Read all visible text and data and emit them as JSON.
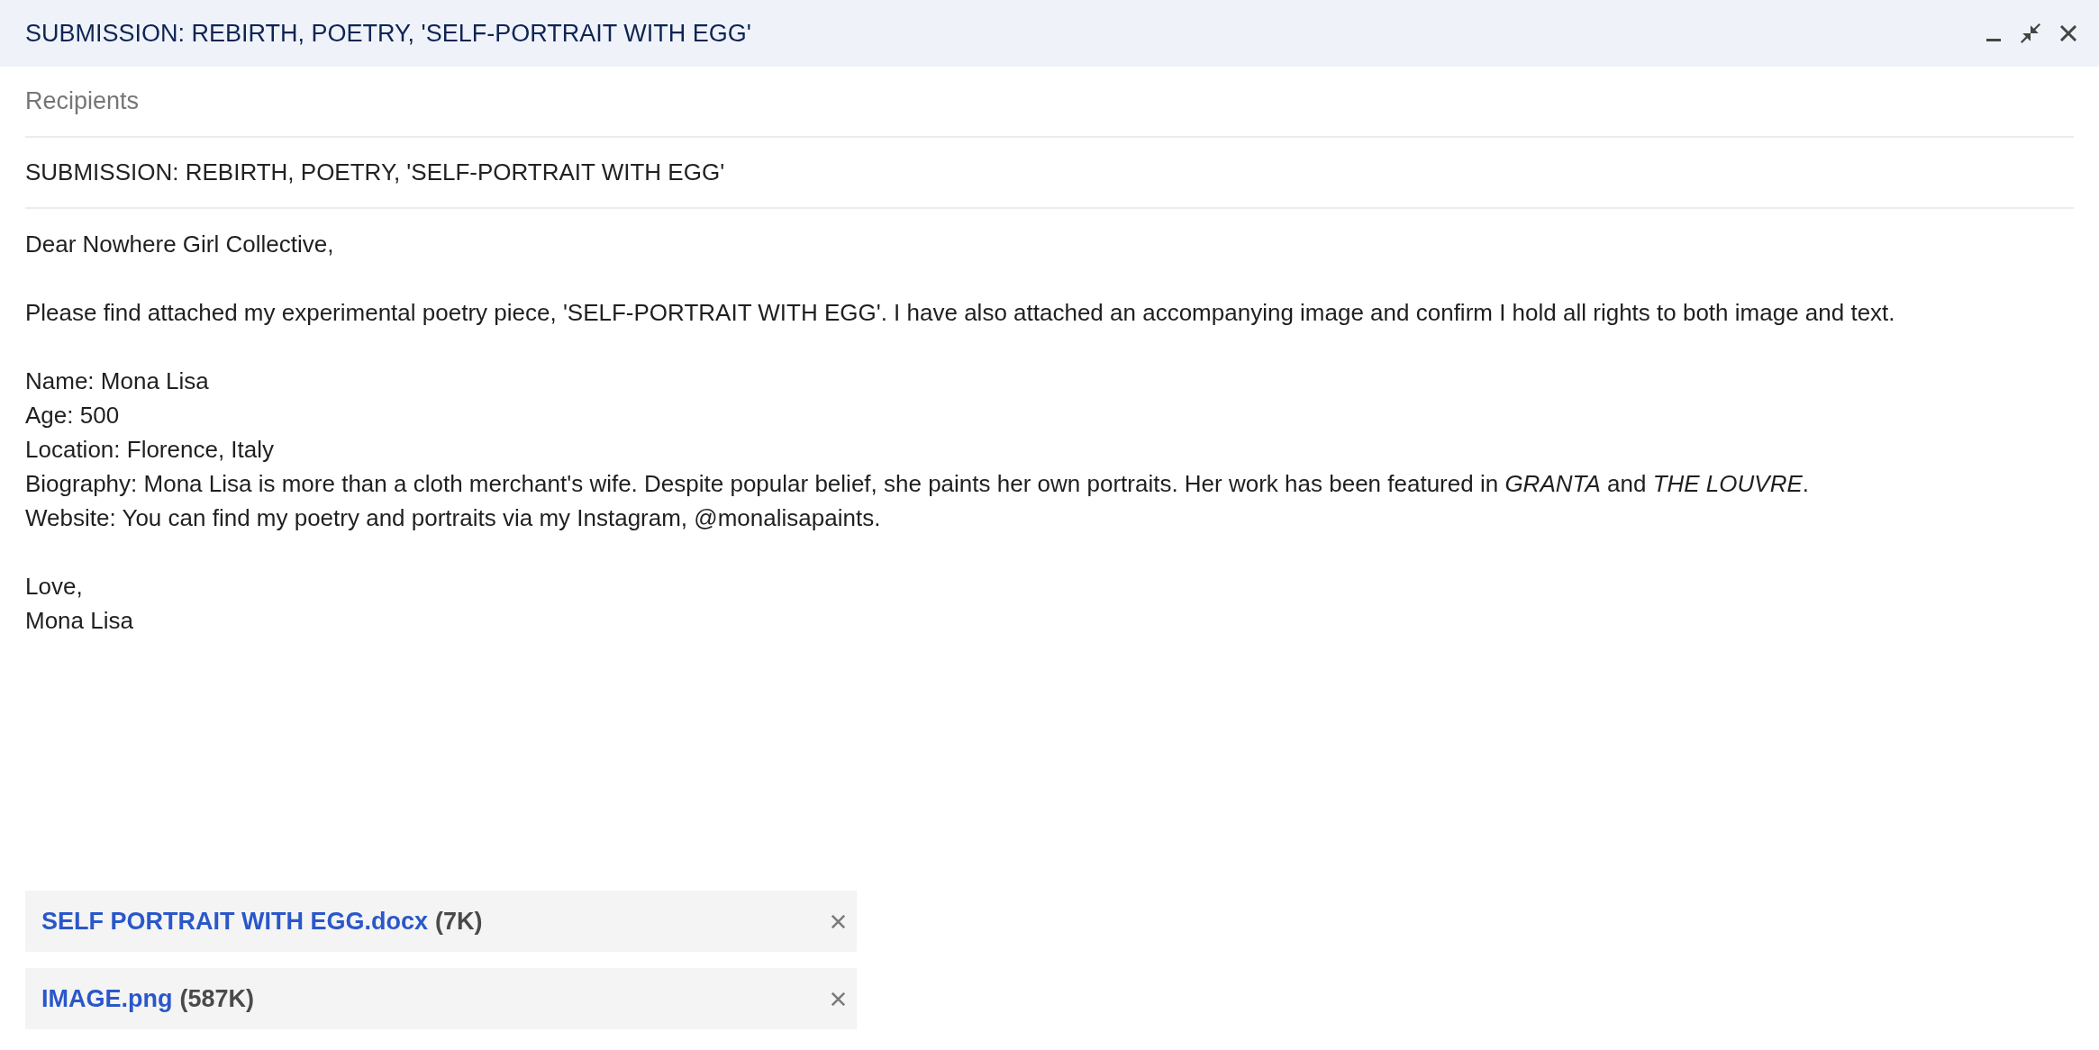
{
  "window": {
    "title": "SUBMISSION: REBIRTH, POETRY, 'SELF-PORTRAIT WITH EGG'"
  },
  "recipients": {
    "placeholder": "Recipients"
  },
  "subject": {
    "value": "SUBMISSION: REBIRTH, POETRY, 'SELF-PORTRAIT WITH EGG'"
  },
  "body": {
    "paragraphs": [
      [
        "Dear Nowhere Girl Collective,"
      ],
      [
        "Please find attached my experimental poetry piece, 'SELF-PORTRAIT WITH EGG'. I have also attached an accompanying image and confirm I hold all rights to both image and text."
      ],
      [
        "Name: Mona Lisa",
        "Age: 500",
        "Location: Florence, Italy",
        "Biography: Mona Lisa is more than a cloth merchant's wife. Despite popular belief, she paints her own portraits. Her work has been featured in *GRANTA* and *THE LOUVRE*.",
        "Website: You can find my poetry and portraits via my Instagram, @monalisapaints."
      ],
      [
        "Love,",
        "Mona Lisa"
      ]
    ]
  },
  "attachments": [
    {
      "name": "SELF PORTRAIT WITH EGG.docx",
      "size": "(7K)"
    },
    {
      "name": "IMAGE.png",
      "size": "(587K)"
    }
  ]
}
